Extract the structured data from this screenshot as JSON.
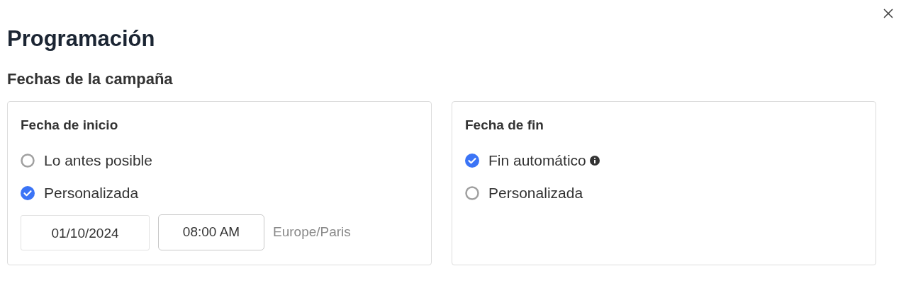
{
  "title": "Programación",
  "section": "Fechas de la campaña",
  "cards": [
    {
      "title": "Fecha de inicio",
      "options": [
        {
          "label": "Lo antes posible",
          "selected": false
        },
        {
          "label": "Personalizada",
          "selected": true
        }
      ],
      "date": "01/10/2024",
      "time": "08:00 AM",
      "timezone": "Europe/Paris"
    },
    {
      "title": "Fecha de fin",
      "options": [
        {
          "label": "Fin automático",
          "selected": true,
          "info": true
        },
        {
          "label": "Personalizada",
          "selected": false
        }
      ]
    }
  ]
}
